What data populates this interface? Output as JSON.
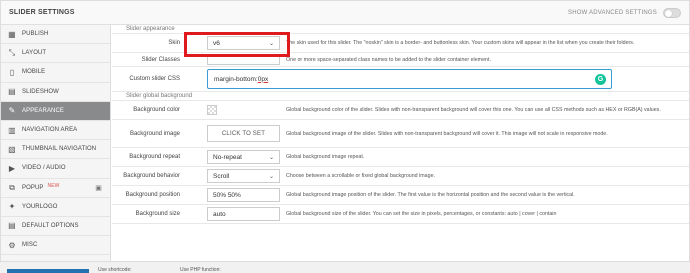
{
  "header": {
    "title": "SLIDER SETTINGS",
    "advanced_label": "SHOW ADVANCED SETTINGS"
  },
  "sidebar": {
    "items": [
      {
        "label": "PUBLISH",
        "icon": "calendar-icon",
        "glyph": "▦"
      },
      {
        "label": "LAYOUT",
        "icon": "layout-icon",
        "glyph": "⤡"
      },
      {
        "label": "MOBILE",
        "icon": "mobile-icon",
        "glyph": "▯"
      },
      {
        "label": "SLIDESHOW",
        "icon": "slideshow-icon",
        "glyph": "▤"
      },
      {
        "label": "APPEARANCE",
        "icon": "brush-icon",
        "glyph": "✎"
      },
      {
        "label": "NAVIGATION AREA",
        "icon": "navigation-icon",
        "glyph": "▥"
      },
      {
        "label": "THUMBNAIL NAVIGATION",
        "icon": "thumbnail-icon",
        "glyph": "▧"
      },
      {
        "label": "VIDEO / AUDIO",
        "icon": "play-icon",
        "glyph": "▶"
      },
      {
        "label": "POPUP",
        "icon": "popup-icon",
        "glyph": "⧉",
        "badge": "NEW"
      },
      {
        "label": "YOURLOGO",
        "icon": "star-icon",
        "glyph": "✦"
      },
      {
        "label": "DEFAULT OPTIONS",
        "icon": "options-icon",
        "glyph": "▤"
      },
      {
        "label": "MISC",
        "icon": "gear-icon",
        "glyph": "⚙"
      }
    ]
  },
  "appearance": {
    "section_label": "Slider appearance",
    "skin": {
      "label": "Skin",
      "value": "v6",
      "desc": "The skin used for this slider. The \"noskin\" skin is a border- and buttonless skin. Your custom skins will appear in the list when you create their folders."
    },
    "classes": {
      "label": "Slider Classes",
      "value": "",
      "desc": "One or more space-separated class names to be added to the slider container element."
    },
    "css": {
      "label": "Custom slider CSS",
      "value_prefix": "margin-bottom: ",
      "value_underlined": "0px"
    }
  },
  "background": {
    "section_label": "Slider global background",
    "color": {
      "label": "Background color",
      "desc": "Global background color of the slider. Slides with non-transparent background will cover this one. You can use all CSS methods such as HEX or RGB(A) values."
    },
    "image": {
      "label": "Background image",
      "button": "CLICK TO SET",
      "desc": "Global background image of the slider. Slides with non-transparent background will cover it. This image will not scale in responsive mode."
    },
    "repeat": {
      "label": "Background repeat",
      "value": "No-repeat",
      "desc": "Global background image repeat."
    },
    "behavior": {
      "label": "Background behavior",
      "value": "Scroll",
      "desc": "Choose between a scrollable or fixed global background image."
    },
    "position": {
      "label": "Background position",
      "value": "50% 50%",
      "desc": "Global background image position of the slider. The first value is the horizontal position and the second value is the vertical."
    },
    "size": {
      "label": "Background size",
      "value": "auto",
      "desc": "Global background size of the slider. You can set the size in pixels, percentages, or constants: auto | cover | contain"
    }
  },
  "footer": {
    "shortcode_label": "Use shortcode:",
    "php_label": "Use PHP function:"
  },
  "colors": {
    "active_sidebar": "#888a8c",
    "highlight": "#e0191c",
    "focus": "#3a9bd5",
    "grammarly": "#15c39a"
  }
}
